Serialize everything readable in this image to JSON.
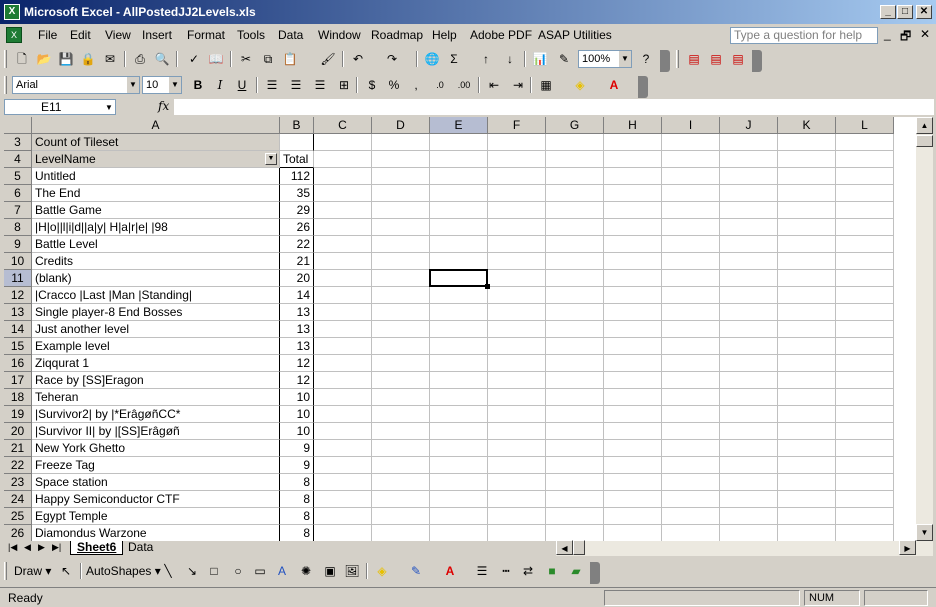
{
  "window": {
    "title": "Microsoft Excel - AllPostedJJ2Levels.xls",
    "app_icon": "X",
    "min": "_",
    "max": "□",
    "close": "✕"
  },
  "menu": {
    "items": [
      "File",
      "Edit",
      "View",
      "Insert",
      "Format",
      "Tools",
      "Data",
      "Window",
      "Roadmap",
      "Help",
      "Adobe PDF",
      "ASAP Utilities"
    ],
    "ask_placeholder": "Type a question for help",
    "doc_min": "_",
    "doc_restore": "🗗",
    "doc_close": "✕"
  },
  "toolbar": {
    "zoom": "100%",
    "font": "Arial",
    "font_size": "10"
  },
  "formula": {
    "name_box": "E11",
    "fx": "fx",
    "value": ""
  },
  "columns": [
    "A",
    "B",
    "C",
    "D",
    "E",
    "F",
    "G",
    "H",
    "I",
    "J",
    "K",
    "L"
  ],
  "active_column": "E",
  "active_row": "11",
  "pivot": {
    "header_label": "Count of Tileset",
    "row_field": "LevelName",
    "total_label": "Total"
  },
  "rows": [
    {
      "n": "3"
    },
    {
      "n": "4"
    },
    {
      "n": "5",
      "name": "Untitled",
      "count": "112"
    },
    {
      "n": "6",
      "name": "The End",
      "count": "35"
    },
    {
      "n": "7",
      "name": "Battle Game",
      "count": "29"
    },
    {
      "n": "8",
      "name": "|H|o||l|i|d||a|y| H|a|r|e| |98",
      "count": "26"
    },
    {
      "n": "9",
      "name": "Battle Level",
      "count": "22"
    },
    {
      "n": "10",
      "name": "Credits",
      "count": "21"
    },
    {
      "n": "11",
      "name": "(blank)",
      "count": "20"
    },
    {
      "n": "12",
      "name": "|Cracco |Last |Man |Standing|",
      "count": "14"
    },
    {
      "n": "13",
      "name": "Single player-8 End Bosses",
      "count": "13"
    },
    {
      "n": "14",
      "name": "Just another level",
      "count": "13"
    },
    {
      "n": "15",
      "name": "Example level",
      "count": "13"
    },
    {
      "n": "16",
      "name": "Ziqqurat 1",
      "count": "12"
    },
    {
      "n": "17",
      "name": "Race by [SS]Eragon",
      "count": "12"
    },
    {
      "n": "18",
      "name": "Teheran",
      "count": "10"
    },
    {
      "n": "19",
      "name": "|Survivor2| by |*ErâgøñCC*",
      "count": "10"
    },
    {
      "n": "20",
      "name": "|Survivor II| by |[SS]Erâgøñ",
      "count": "10"
    },
    {
      "n": "21",
      "name": "New York Ghetto",
      "count": "9"
    },
    {
      "n": "22",
      "name": "Freeze Tag",
      "count": "9"
    },
    {
      "n": "23",
      "name": "Space station",
      "count": "8"
    },
    {
      "n": "24",
      "name": "Happy Semiconductor CTF",
      "count": "8"
    },
    {
      "n": "25",
      "name": "Egypt Temple",
      "count": "8"
    },
    {
      "n": "26",
      "name": "Diamondus Warzone",
      "count": "8"
    }
  ],
  "tabs": [
    "Sheet6",
    "Data"
  ],
  "drawbar": {
    "draw": "Draw ▾",
    "autoshapes": "AutoShapes ▾"
  },
  "status": {
    "text": "Ready",
    "num": "NUM"
  }
}
